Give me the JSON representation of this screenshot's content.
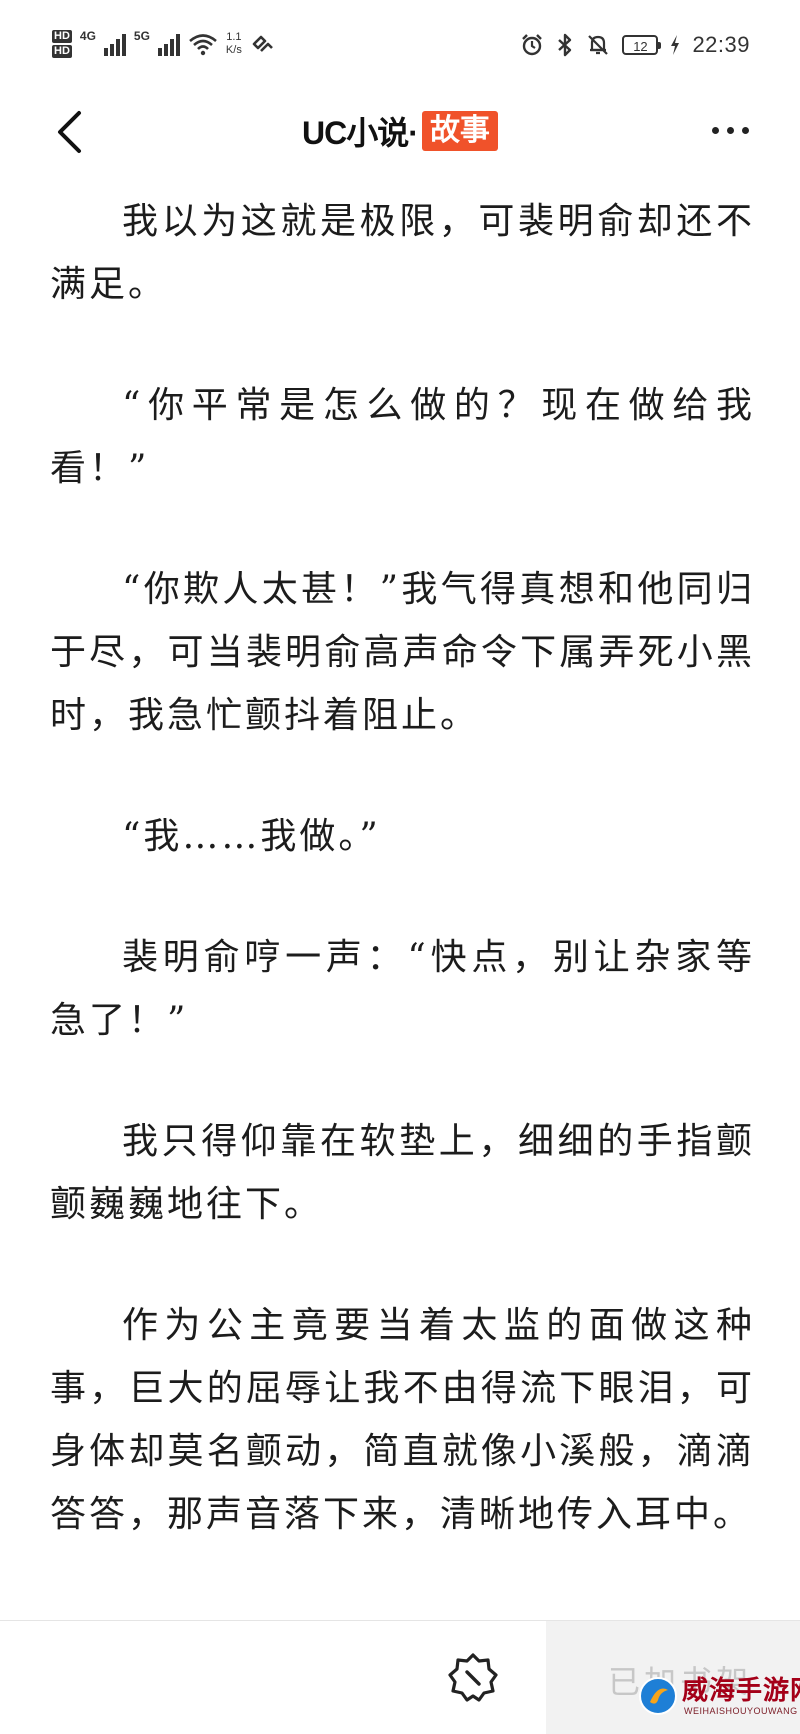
{
  "status_bar": {
    "hd_top": "HD",
    "hd_bottom": "HD",
    "network_1": "4G",
    "network_2": "5G",
    "speed_value": "1.1",
    "speed_unit": "K/s",
    "battery": "12",
    "time": "22:39",
    "icons": [
      "signal-icon",
      "wifi-icon",
      "nfc-icon",
      "alarm-icon",
      "bluetooth-icon",
      "mute-icon",
      "battery-icon",
      "charging-icon"
    ]
  },
  "header": {
    "title": "UC小说·",
    "tag": "故事",
    "back_icon": "chevron-left-icon",
    "more_icon": "more-horizontal-icon",
    "tag_color": "#f0522a"
  },
  "paragraphs": [
    "我以为这就是极限，可裴明俞却还不满足。",
    "“你平常是怎么做的？现在做给我看！”",
    "“你欺人太甚！”我气得真想和他同归于尽，可当裴明俞高声命令下属弄死小黑时，我急忙颤抖着阻止。",
    "“我……我做。”",
    "裴明俞哼一声：“快点，别让杂家等急了！”",
    "我只得仰靠在软垫上，细细的手指颤颤巍巍地往下。",
    "作为公主竟要当着太监的面做这种事，巨大的屈辱让我不由得流下眼泪，可身体却莫名颤动，简直就像小溪般，滴滴答答，那声音落下来，清晰地传入耳中。"
  ],
  "bottom_bar": {
    "settings_icon": "settings-icon",
    "shelf_label": "已加书架"
  },
  "watermark": {
    "text": "威海手游网",
    "sub": "WEIHAISHOUYOUWANG"
  }
}
